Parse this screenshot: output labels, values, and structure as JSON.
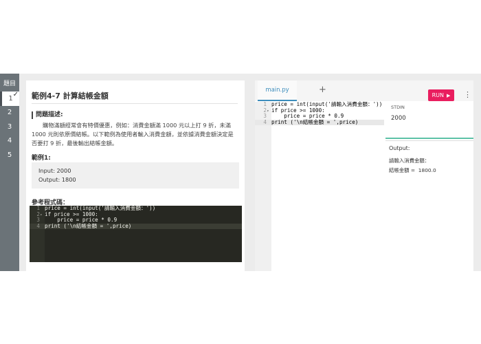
{
  "sidebar": {
    "header": "題目",
    "items": [
      {
        "label": "1",
        "active": true
      },
      {
        "label": "2",
        "active": false
      },
      {
        "label": "3",
        "active": false
      },
      {
        "label": "4",
        "active": false
      },
      {
        "label": "5",
        "active": false
      }
    ],
    "check": "✓"
  },
  "problem": {
    "title": "範例4-7 計算結帳金額",
    "desc_heading": "問題描述:",
    "description": "購物滿額經常會有特價優惠，例如：消費金額滿 1000 元以上打 9 折，未滿 1000 元則依原價結帳。以下範例為使用者輸入消費金額，並依據消費金額決定是否要打 9 折，最後輸出結帳金額。",
    "example_heading": "範例1:",
    "example": {
      "input": "Input:  2000",
      "output": "Output:  1800"
    },
    "reference_heading": "參考程式碼："
  },
  "code_lines": [
    {
      "n": "1",
      "text": "price = int(input('請輸入消費金額：'))",
      "fold": ""
    },
    {
      "n": "2",
      "text": "if price >= 1000:",
      "fold": "▾"
    },
    {
      "n": "3",
      "text": "    price = price * 0.9",
      "fold": ""
    },
    {
      "n": "4",
      "text": "print ('\\n結帳金額 = ',price)",
      "fold": ""
    }
  ],
  "editor": {
    "tab": "main.py",
    "add": "+",
    "run_label": "RUN",
    "run_icon": "▶",
    "menu": "⋮",
    "stdin_label": "STDIN",
    "stdin_value": "2000",
    "output_label": "Output:",
    "output_lines": [
      "請輸入消費金額：",
      "結帳金額 =  1800.0"
    ]
  },
  "colors": {
    "accent": "#e91e5f",
    "tab": "#3c8dbc",
    "stdin_border": "#5cc1a6",
    "rail": "#6b7378"
  }
}
